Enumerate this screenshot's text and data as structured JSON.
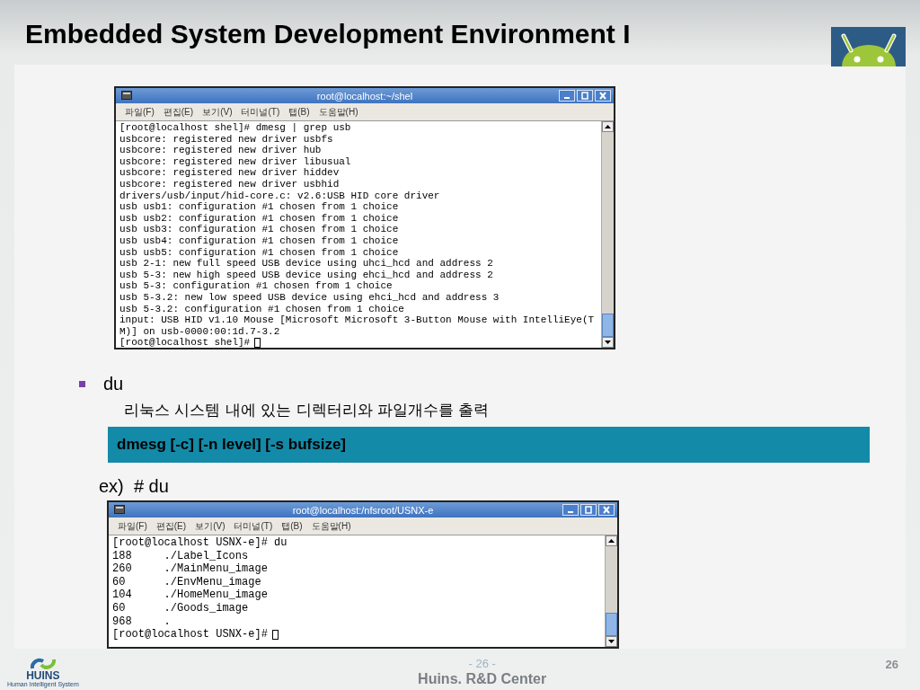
{
  "slide": {
    "title": "Embedded System Development Environment I",
    "bullet": "du",
    "description": "리눅스 시스템 내에 있는 디렉터리와 파일개수를 출력",
    "syntax": "dmesg [-c] [-n level] [-s bufsize]",
    "example_label": "ex)  # du",
    "watermark_number": "- 26 -",
    "footer": "Huins. R&D Center",
    "page_number": "26",
    "logo_text": "HUINS",
    "logo_tagline": "Human Intelligent System"
  },
  "terminals": [
    {
      "title": "root@localhost:~/shel",
      "menu": [
        "파일(F)",
        "편집(E)",
        "보기(V)",
        "터미널(T)",
        "탭(B)",
        "도움말(H)"
      ],
      "lines": [
        "[root@localhost shel]# dmesg | grep usb",
        "usbcore: registered new driver usbfs",
        "usbcore: registered new driver hub",
        "usbcore: registered new driver libusual",
        "usbcore: registered new driver hiddev",
        "usbcore: registered new driver usbhid",
        "drivers/usb/input/hid-core.c: v2.6:USB HID core driver",
        "usb usb1: configuration #1 chosen from 1 choice",
        "usb usb2: configuration #1 chosen from 1 choice",
        "usb usb3: configuration #1 chosen from 1 choice",
        "usb usb4: configuration #1 chosen from 1 choice",
        "usb usb5: configuration #1 chosen from 1 choice",
        "usb 2-1: new full speed USB device using uhci_hcd and address 2",
        "usb 5-3: new high speed USB device using ehci_hcd and address 2",
        "usb 5-3: configuration #1 chosen from 1 choice",
        "usb 5-3.2: new low speed USB device using ehci_hcd and address 3",
        "usb 5-3.2: configuration #1 chosen from 1 choice",
        "input: USB HID v1.10 Mouse [Microsoft Microsoft 3-Button Mouse with IntelliEye(T",
        "M)] on usb-0000:00:1d.7-3.2",
        "[root@localhost shel]#"
      ]
    },
    {
      "title": "root@localhost:/nfsroot/USNX-e",
      "menu": [
        "파일(F)",
        "편집(E)",
        "보기(V)",
        "터미널(T)",
        "탭(B)",
        "도움말(H)"
      ],
      "lines": [
        "[root@localhost USNX-e]# du",
        "188     ./Label_Icons",
        "260     ./MainMenu_image",
        "60      ./EnvMenu_image",
        "104     ./HomeMenu_image",
        "60      ./Goods_image",
        "968     .",
        "[root@localhost USNX-e]#"
      ]
    }
  ]
}
